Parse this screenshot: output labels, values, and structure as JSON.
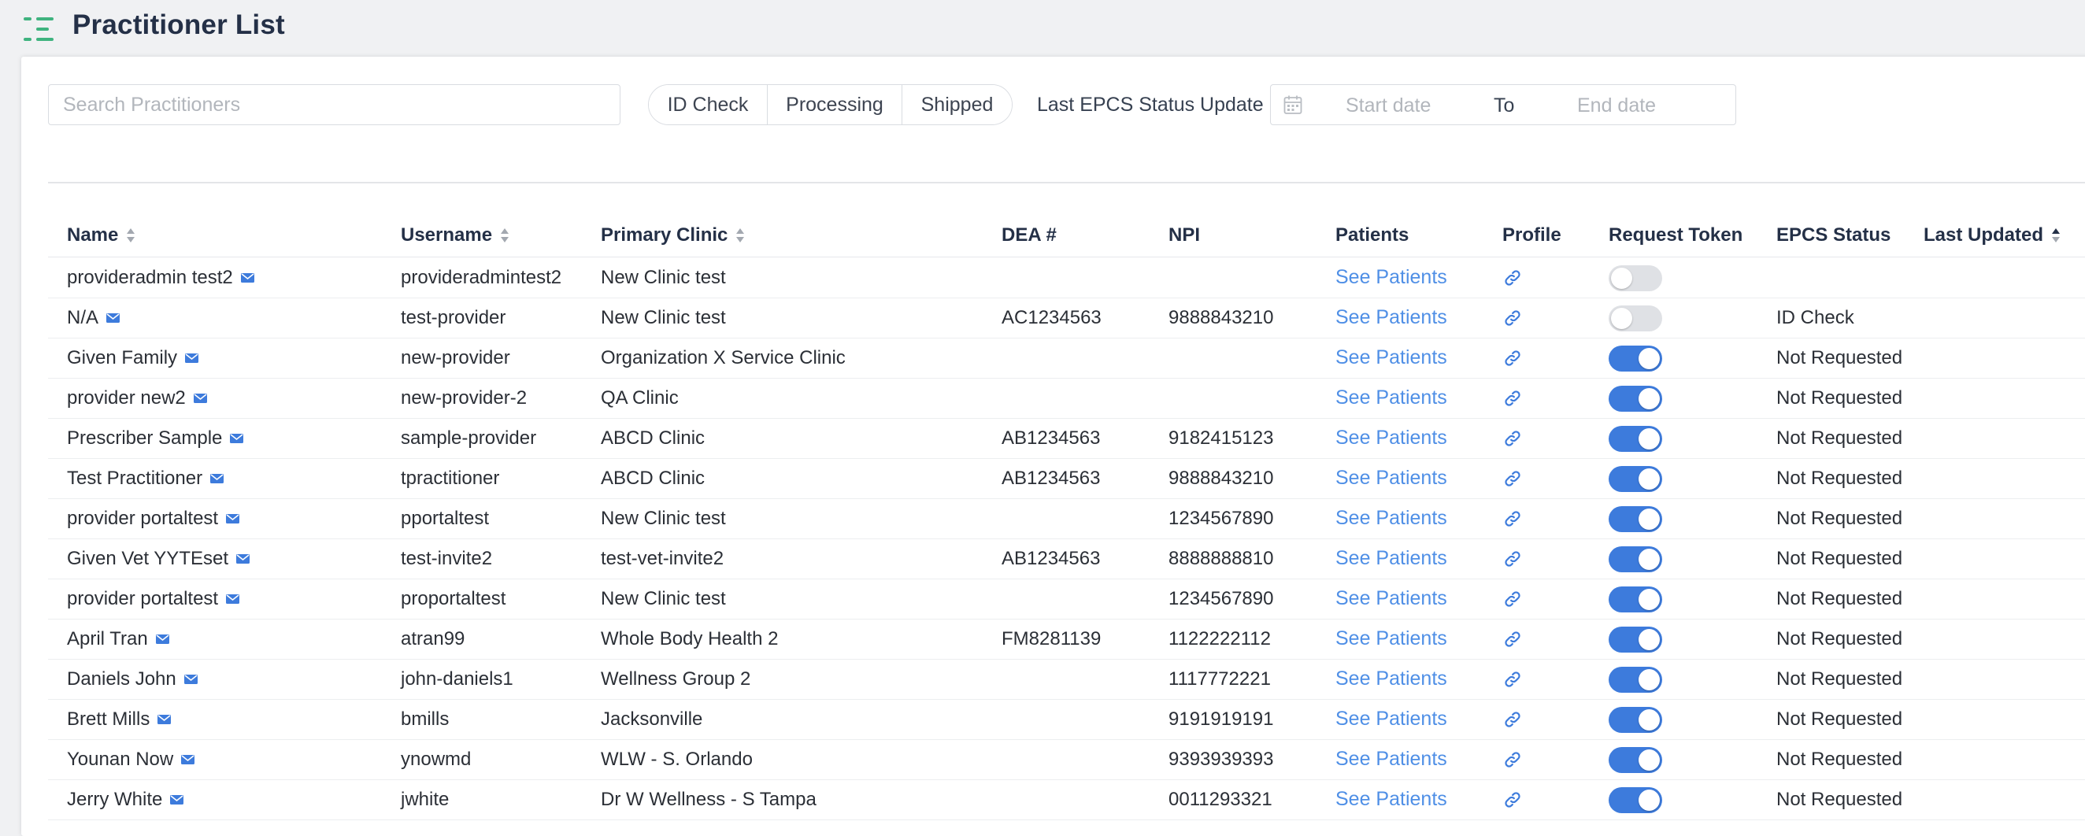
{
  "header": {
    "title": "Practitioner List"
  },
  "filters": {
    "search_placeholder": "Search Practitioners",
    "status_tabs": [
      {
        "label": "ID Check"
      },
      {
        "label": "Processing"
      },
      {
        "label": "Shipped"
      }
    ],
    "date_label": "Last EPCS Status Update",
    "start_placeholder": "Start date",
    "to_label": "To",
    "end_placeholder": "End date"
  },
  "table": {
    "columns": [
      "Name",
      "Username",
      "Primary Clinic",
      "DEA #",
      "NPI",
      "Patients",
      "Profile",
      "Request Token",
      "EPCS Status",
      "Last Updated"
    ],
    "sorted_column": "Last Updated",
    "rows": [
      {
        "name": "provideradmin test2",
        "username": "provideradmintest2",
        "clinic": "New Clinic test",
        "dea": "",
        "npi": "",
        "patients": "See Patients",
        "token_enabled": false,
        "epcs": ""
      },
      {
        "name": "N/A",
        "username": "test-provider",
        "clinic": "New Clinic test",
        "dea": "AC1234563",
        "npi": "9888843210",
        "patients": "See Patients",
        "token_enabled": false,
        "epcs": "ID Check"
      },
      {
        "name": "Given Family",
        "username": "new-provider",
        "clinic": "Organization X Service Clinic",
        "dea": "",
        "npi": "",
        "patients": "See Patients",
        "token_enabled": true,
        "epcs": "Not Requested"
      },
      {
        "name": "provider new2",
        "username": "new-provider-2",
        "clinic": "QA Clinic",
        "dea": "",
        "npi": "",
        "patients": "See Patients",
        "token_enabled": true,
        "epcs": "Not Requested"
      },
      {
        "name": "Prescriber Sample",
        "username": "sample-provider",
        "clinic": "ABCD Clinic",
        "dea": "AB1234563",
        "npi": "9182415123",
        "patients": "See Patients",
        "token_enabled": true,
        "epcs": "Not Requested"
      },
      {
        "name": "Test Practitioner",
        "username": "tpractitioner",
        "clinic": "ABCD Clinic",
        "dea": "AB1234563",
        "npi": "9888843210",
        "patients": "See Patients",
        "token_enabled": true,
        "epcs": "Not Requested"
      },
      {
        "name": "provider portaltest",
        "username": "pportaltest",
        "clinic": "New Clinic test",
        "dea": "",
        "npi": "1234567890",
        "patients": "See Patients",
        "token_enabled": true,
        "epcs": "Not Requested"
      },
      {
        "name": "Given Vet YYTEset",
        "username": "test-invite2",
        "clinic": "test-vet-invite2",
        "dea": "AB1234563",
        "npi": "8888888810",
        "patients": "See Patients",
        "token_enabled": true,
        "epcs": "Not Requested"
      },
      {
        "name": "provider portaltest",
        "username": "proportaltest",
        "clinic": "New Clinic test",
        "dea": "",
        "npi": "1234567890",
        "patients": "See Patients",
        "token_enabled": true,
        "epcs": "Not Requested"
      },
      {
        "name": "April Tran",
        "username": "atran99",
        "clinic": "Whole Body Health 2",
        "dea": "FM8281139",
        "npi": "1122222112",
        "patients": "See Patients",
        "token_enabled": true,
        "epcs": "Not Requested"
      },
      {
        "name": "Daniels John",
        "username": "john-daniels1",
        "clinic": "Wellness Group 2",
        "dea": "",
        "npi": "1117772221",
        "patients": "See Patients",
        "token_enabled": true,
        "epcs": "Not Requested"
      },
      {
        "name": "Brett Mills",
        "username": "bmills",
        "clinic": "Jacksonville",
        "dea": "",
        "npi": "9191919191",
        "patients": "See Patients",
        "token_enabled": true,
        "epcs": "Not Requested"
      },
      {
        "name": "Younan Now",
        "username": "ynowmd",
        "clinic": "WLW - S. Orlando",
        "dea": "",
        "npi": "9393939393",
        "patients": "See Patients",
        "token_enabled": true,
        "epcs": "Not Requested"
      },
      {
        "name": "Jerry White",
        "username": "jwhite",
        "clinic": "Dr W Wellness - S Tampa",
        "dea": "",
        "npi": "0011293321",
        "patients": "See Patients",
        "token_enabled": true,
        "epcs": "Not Requested"
      }
    ]
  },
  "colors": {
    "accent_green": "#3fb37f",
    "link_blue": "#4f8fe6",
    "toggle_on": "#3d7bdc",
    "toggle_off": "#dfe1e5",
    "title_navy": "#243047"
  },
  "icons": {
    "menu": "menu-icon",
    "calendar": "calendar-icon",
    "sort": "sort-icon",
    "mail": "mail-icon",
    "profile": "link-icon"
  }
}
